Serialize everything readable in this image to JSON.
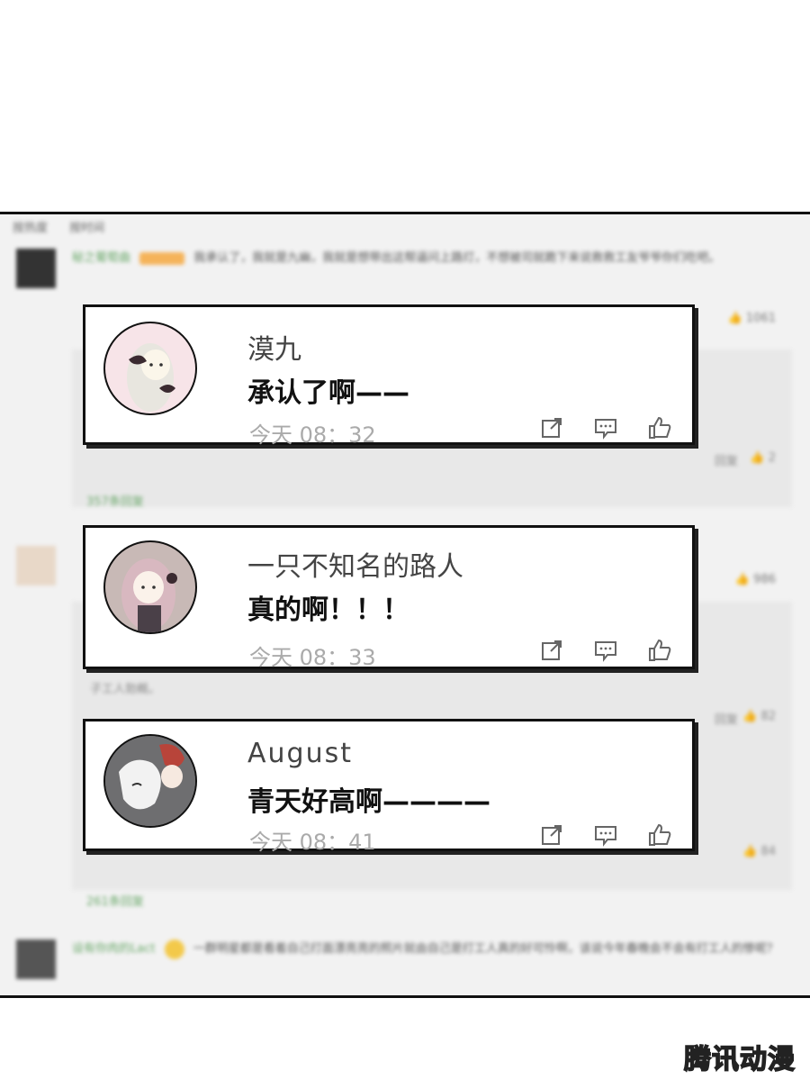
{
  "background": {
    "tabs": [
      "按热度",
      "按时间"
    ],
    "posts": [
      {
        "user": "秘之葡萄曲",
        "text": "我承认了，我就是九幽，我就是想带出这帮逼问上路灯，不想被司就跪下来说救救工友爷爷你们吃吧。",
        "likes": "1061",
        "reply_count_link": "357条回复",
        "reply_likes": "2",
        "reply_label": "回复"
      },
      {
        "user": "",
        "likes": "986",
        "reply_likes": "82",
        "reply_likes_2": "84",
        "reply_count_link": "261条回复",
        "reply_fragment": "子工人勃概。",
        "reply_label": "回复"
      },
      {
        "user": "设有你肉的Lact",
        "text": "一群明星都是看着自己打面漂亮亮的照片就由自己是打工人真的好可怜啊，该说今年春晚会不会有打工人的惨呢？"
      }
    ]
  },
  "comments": [
    {
      "username": "漠九",
      "text": "承认了啊——",
      "time": "今天 08：32",
      "avatar_icon": "anime-girl-bow-avatar"
    },
    {
      "username": "一只不知名的路人",
      "text": "真的啊！！！",
      "time": "今天 08：33",
      "avatar_icon": "anime-girl-pink-hair-avatar"
    },
    {
      "username": "August",
      "text": "青天好高啊————",
      "time": "今天 08：41",
      "avatar_icon": "anime-duo-avatar"
    }
  ],
  "watermark": "腾讯动漫",
  "icons": [
    "share-icon",
    "comment-icon",
    "like-icon"
  ]
}
